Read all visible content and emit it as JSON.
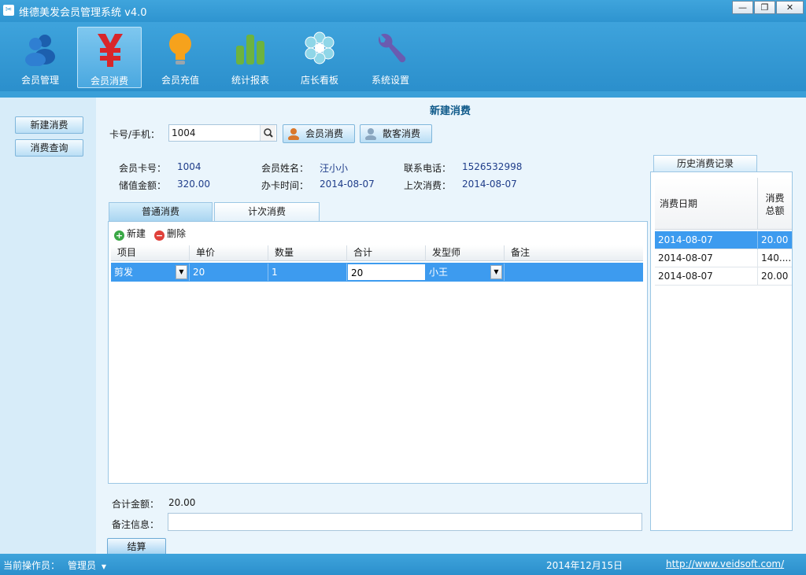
{
  "window": {
    "title": "维德美发会员管理系统 v4.0",
    "min_label": "—",
    "max_label": "❐",
    "close_label": "✕"
  },
  "toolbar": {
    "items": [
      {
        "label": "会员管理",
        "icon": "members-icon"
      },
      {
        "label": "会员消费",
        "icon": "yen-icon"
      },
      {
        "label": "会员充值",
        "icon": "bulb-icon"
      },
      {
        "label": "统计报表",
        "icon": "bar-chart-icon"
      },
      {
        "label": "店长看板",
        "icon": "flower-icon"
      },
      {
        "label": "系统设置",
        "icon": "wrench-icon"
      }
    ],
    "active_index": 1
  },
  "sidebar": {
    "items": [
      "新建消费",
      "消费查询"
    ]
  },
  "page": {
    "title": "新建消费"
  },
  "search": {
    "label": "卡号/手机：",
    "value": "1004",
    "member_btn": "会员消费",
    "guest_btn": "散客消费"
  },
  "member": {
    "card_label": "会员卡号：",
    "card": "1004",
    "name_label": "会员姓名：",
    "name": "汪小小",
    "phone_label": "联系电话：",
    "phone": "1526532998",
    "balance_label": "储值金额：",
    "balance": "320.00",
    "open_label": "办卡时间：",
    "open_date": "2014-08-07",
    "last_label": "上次消费：",
    "last_date": "2014-08-07"
  },
  "tabs": [
    "普通消费",
    "计次消费"
  ],
  "grid": {
    "new_label": "新建",
    "delete_label": "删除",
    "columns": [
      "项目",
      "单价",
      "数量",
      "合计",
      "发型师",
      "备注"
    ],
    "rows": [
      {
        "item": "剪发",
        "price": "20",
        "qty": "1",
        "total": "20",
        "stylist": "小王",
        "note": ""
      }
    ]
  },
  "history": {
    "tab_label": "历史消费记录",
    "col_date": "消费日期",
    "col_total": "消费\n总额",
    "rows": [
      {
        "date": "2014-08-07",
        "total": "20.00"
      },
      {
        "date": "2014-08-07",
        "total": "140...."
      },
      {
        "date": "2014-08-07",
        "total": "20.00"
      }
    ]
  },
  "summary": {
    "total_label": "合计金额：",
    "total_value": "20.00",
    "note_label": "备注信息：",
    "settle_btn": "结算"
  },
  "status": {
    "operator_label": "当前操作员：",
    "operator": "管理员",
    "date": "2014年12月15日",
    "url": "http://www.veidsoft.com/"
  }
}
